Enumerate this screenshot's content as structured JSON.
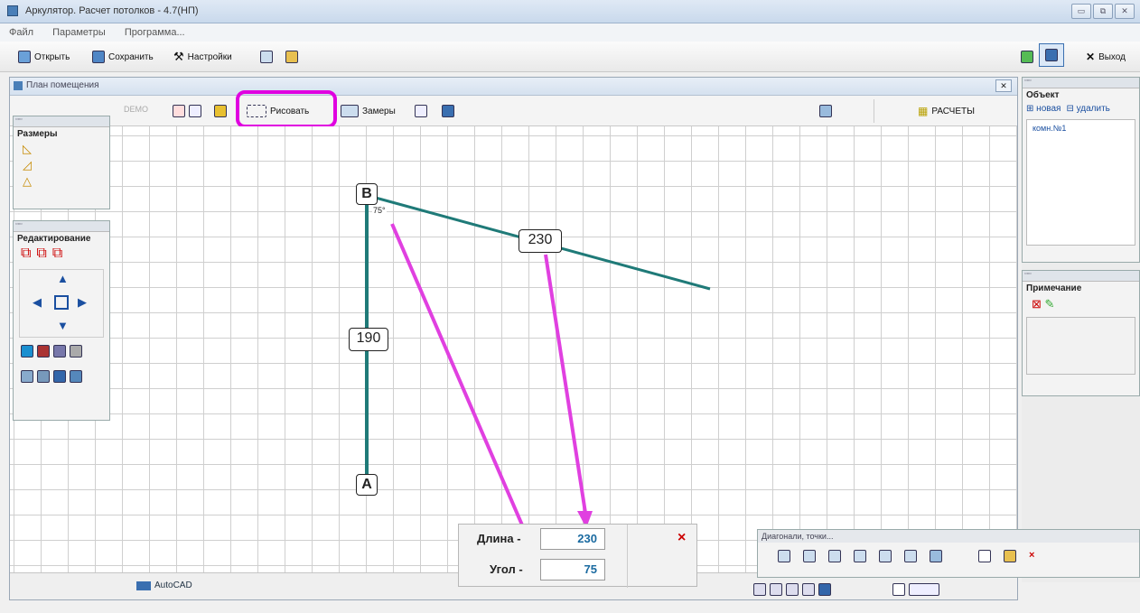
{
  "window": {
    "title": "Аркулятор. Расчет потолков - 4.7(НП)",
    "buttons": [
      "▭",
      "⧉",
      "✕"
    ]
  },
  "menu": [
    "Файл",
    "Параметры",
    "Программа..."
  ],
  "toolbar": {
    "open": "Открыть",
    "save": "Сохранить",
    "settings": "Настройки",
    "exit": "Выход"
  },
  "plan": {
    "title": "План помещения",
    "demo": "DEMO",
    "draw": "Рисовать",
    "measure": "Замеры",
    "calc": "РАСЧЕТЫ"
  },
  "sizes_panel": {
    "title": "Размеры"
  },
  "edit_panel": {
    "title": "Редактирование"
  },
  "object_panel": {
    "title": "Объект",
    "new": "новая",
    "delete": "удалить",
    "items": [
      "комн.№1"
    ]
  },
  "note_panel": {
    "title": "Примечание"
  },
  "drawing": {
    "point_a": "A",
    "point_b": "B",
    "angle_mark": "75°",
    "len_ab": "190",
    "len_b": "230",
    "segment_color": "#1f7a78",
    "annotation_color": "#e040e0"
  },
  "input": {
    "length_label": "Длина -",
    "length_value": "230",
    "angle_label": "Угол -",
    "angle_value": "75",
    "close": "×"
  },
  "diag_panel": {
    "title": "Диагонали, точки..."
  },
  "status": {
    "autocad": "AutoCAD"
  }
}
